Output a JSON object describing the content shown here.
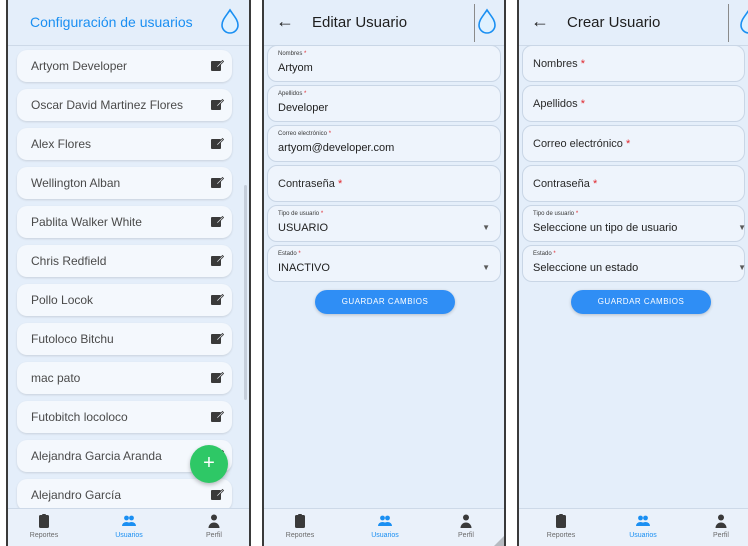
{
  "screen1": {
    "title": "Configuración de usuarios",
    "users": [
      {
        "name": "Artyom Developer"
      },
      {
        "name": "Oscar David Martinez Flores"
      },
      {
        "name": "Alex Flores"
      },
      {
        "name": "Wellington Alban"
      },
      {
        "name": "Pablita Walker White"
      },
      {
        "name": "Chris Redfield"
      },
      {
        "name": "Pollo Locok"
      },
      {
        "name": "Futoloco Bitchu"
      },
      {
        "name": "mac pato"
      },
      {
        "name": "Futobitch locoloco"
      },
      {
        "name": "Alejandra Garcia Aranda"
      },
      {
        "name": "Alejandro García"
      }
    ],
    "fab_label": "+"
  },
  "screen2": {
    "back": "←",
    "title": "Editar Usuario",
    "fields": {
      "nombres": {
        "label": "Nombres",
        "value": "Artyom"
      },
      "apellidos": {
        "label": "Apellidos",
        "value": "Developer"
      },
      "correo": {
        "label": "Correo electrónico",
        "value": "artyom@developer.com"
      },
      "contrasena": {
        "label": "Contraseña"
      },
      "tipo": {
        "label": "Tipo de usuario",
        "value": "USUARIO"
      },
      "estado": {
        "label": "Estado",
        "value": "INACTIVO"
      }
    },
    "save_label": "GUARDAR CAMBIOS"
  },
  "screen3": {
    "back": "←",
    "title": "Crear Usuario",
    "fields": {
      "nombres": {
        "label": "Nombres"
      },
      "apellidos": {
        "label": "Apellidos"
      },
      "correo": {
        "label": "Correo electrónico"
      },
      "contrasena": {
        "label": "Contraseña"
      },
      "tipo": {
        "label": "Tipo de usuario",
        "placeholder": "Seleccione un tipo de usuario"
      },
      "estado": {
        "label": "Estado",
        "placeholder": "Seleccione un estado"
      }
    },
    "save_label": "GUARDAR CAMBIOS"
  },
  "required_mark": "*",
  "bottom_nav": {
    "reportes": "Reportes",
    "usuarios": "Usuarios",
    "perfil": "Perfil",
    "active": "usuarios"
  },
  "icons": {
    "app": "water-drop-icon",
    "edit": "edit-icon",
    "back": "arrow-left-icon",
    "reportes": "clipboard-icon",
    "usuarios": "users-icon",
    "perfil": "person-icon",
    "select": "caret-down-icon"
  },
  "colors": {
    "accent": "#1a8ff2",
    "background": "#e4eefa",
    "fab": "#2ec866",
    "required": "#e0262c",
    "button": "#2f8ef5"
  }
}
